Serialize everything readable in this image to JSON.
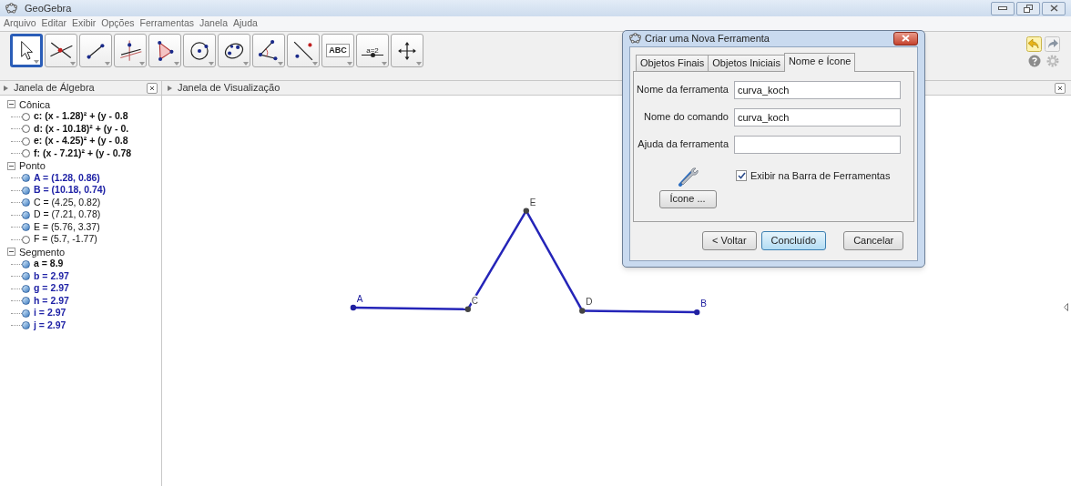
{
  "window": {
    "title": "GeoGebra"
  },
  "menu": [
    "Arquivo",
    "Editar",
    "Exibir",
    "Opções",
    "Ferramentas",
    "Janela",
    "Ajuda"
  ],
  "toolbar": [
    {
      "kind": "move",
      "selected": true
    },
    {
      "kind": "intersect",
      "selected": false
    },
    {
      "kind": "segment",
      "selected": false
    },
    {
      "kind": "perpendicular",
      "selected": false
    },
    {
      "kind": "polygon",
      "selected": false
    },
    {
      "kind": "circle",
      "selected": false
    },
    {
      "kind": "conic",
      "selected": false
    },
    {
      "kind": "angle",
      "selected": false
    },
    {
      "kind": "reflect",
      "selected": false
    },
    {
      "kind": "text",
      "label": "ABC",
      "selected": false
    },
    {
      "kind": "slider",
      "label": "a=2",
      "selected": false
    },
    {
      "kind": "pan",
      "selected": false
    }
  ],
  "algebra": {
    "title": "Janela de Álgebra",
    "groups": [
      {
        "label": "Cônica",
        "expanded": true,
        "children": [
          {
            "text": "c: (x - 1.28)² + (y - 0.8",
            "visible": false,
            "selected": false,
            "bold": true
          },
          {
            "text": "d: (x - 10.18)² + (y - 0.",
            "visible": false,
            "selected": false,
            "bold": true
          },
          {
            "text": "e: (x - 4.25)² + (y - 0.8",
            "visible": false,
            "selected": false,
            "bold": true
          },
          {
            "text": "f: (x - 7.21)² + (y - 0.78",
            "visible": false,
            "selected": false,
            "bold": true
          }
        ]
      },
      {
        "label": "Ponto",
        "expanded": true,
        "children": [
          {
            "text": "A = (1.28, 0.86)",
            "visible": true,
            "selected": true,
            "bold": true
          },
          {
            "text": "B = (10.18, 0.74)",
            "visible": true,
            "selected": true,
            "bold": true
          },
          {
            "text": "C = (4.25, 0.82)",
            "visible": true,
            "selected": false,
            "bold": false
          },
          {
            "text": "D = (7.21, 0.78)",
            "visible": true,
            "selected": false,
            "bold": false
          },
          {
            "text": "E = (5.76, 3.37)",
            "visible": true,
            "selected": false,
            "bold": false
          },
          {
            "text": "F = (5.7, -1.77)",
            "visible": false,
            "selected": false,
            "bold": false
          }
        ]
      },
      {
        "label": "Segmento",
        "expanded": true,
        "children": [
          {
            "text": "a = 8.9",
            "visible": true,
            "selected": false,
            "bold": true
          },
          {
            "text": "b = 2.97",
            "visible": true,
            "selected": true,
            "bold": true
          },
          {
            "text": "g = 2.97",
            "visible": true,
            "selected": true,
            "bold": true
          },
          {
            "text": "h = 2.97",
            "visible": true,
            "selected": true,
            "bold": true
          },
          {
            "text": "i = 2.97",
            "visible": true,
            "selected": true,
            "bold": true
          },
          {
            "text": "j = 2.97",
            "visible": true,
            "selected": true,
            "bold": true
          }
        ]
      }
    ]
  },
  "graphics": {
    "title": "Janela de Visualização",
    "point_labels": [
      "A",
      "C",
      "E",
      "D",
      "B"
    ]
  },
  "dialog": {
    "title": "Criar uma Nova Ferramenta",
    "tabs": [
      {
        "label": "Objetos Finais",
        "selected": false
      },
      {
        "label": "Objetos Iniciais",
        "selected": false
      },
      {
        "label": "Nome e Ícone",
        "selected": true
      }
    ],
    "fields": [
      {
        "label": "Nome da ferramenta",
        "value": "curva_koch"
      },
      {
        "label": "Nome do comando",
        "value": "curva_koch"
      },
      {
        "label": "Ajuda da ferramenta"
      }
    ],
    "icon_button": "Ícone ...",
    "checkbox": {
      "label": "Exibir na Barra de Ferramentas",
      "checked": true
    },
    "buttons": [
      {
        "label": "< Voltar",
        "default": false
      },
      {
        "label": "Concluído",
        "default": true
      },
      {
        "label": "Cancelar",
        "default": false
      }
    ]
  }
}
